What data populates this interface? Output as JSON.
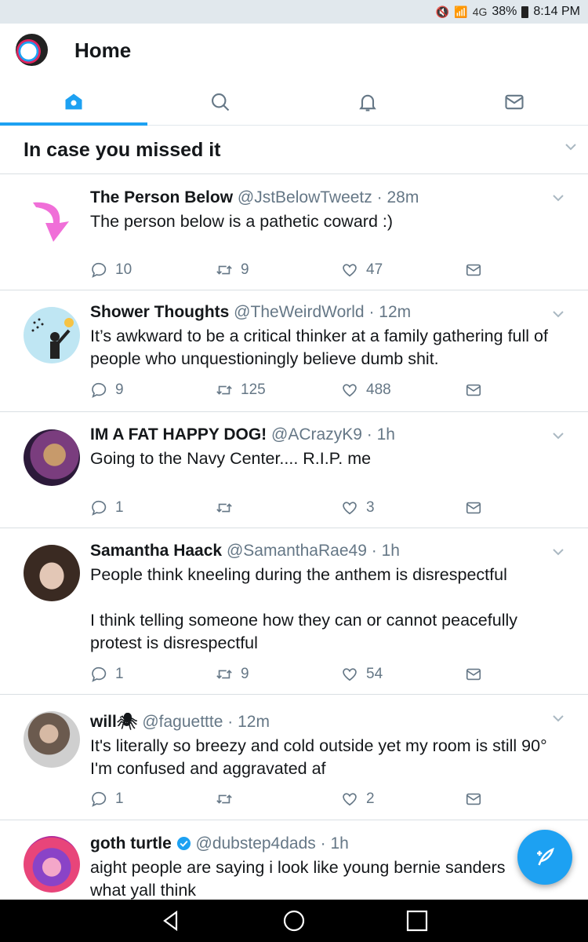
{
  "status_bar": {
    "network": "4G",
    "battery": "38%",
    "time": "8:14 PM"
  },
  "header": {
    "title": "Home"
  },
  "tabs": [
    {
      "icon": "home-icon",
      "active": true
    },
    {
      "icon": "search-icon",
      "active": false
    },
    {
      "icon": "bell-icon",
      "active": false
    },
    {
      "icon": "mail-icon",
      "active": false
    }
  ],
  "section": {
    "title": "In case you missed it"
  },
  "tweets": [
    {
      "name": "The Person Below",
      "handle": "@JstBelowTweetz",
      "time": "28m",
      "text": "The person below is a pathetic coward :)",
      "replies": "10",
      "retweets": "9",
      "likes": "47"
    },
    {
      "name": "Shower Thoughts",
      "handle": "@TheWeirdWorld",
      "time": "12m",
      "text": "It’s awkward to be a critical thinker at a family gathering full of people who unquestioningly believe dumb shit.",
      "replies": "9",
      "retweets": "125",
      "likes": "488"
    },
    {
      "name": "IM A FAT HAPPY DOG!",
      "handle": "@ACrazyK9",
      "time": "1h",
      "text": "Going to the Navy Center.... R.I.P. me",
      "replies": "1",
      "retweets": "",
      "likes": "3"
    },
    {
      "name": "Samantha Haack",
      "handle": "@SamanthaRae49",
      "time": "1h",
      "text": "People think kneeling during the anthem is disrespectful",
      "text2": "I think telling someone how they can or cannot peacefully protest is disrespectful",
      "replies": "1",
      "retweets": "9",
      "likes": "54"
    },
    {
      "name": "will🕷",
      "handle": "@faguettte",
      "time": "12m",
      "text": "It's literally so breezy and cold outside yet my room is still 90° I'm confused and aggravated af",
      "replies": "1",
      "retweets": "",
      "likes": "2"
    },
    {
      "name": "goth turtle",
      "handle": "@dubstep4dads",
      "time": "1h",
      "text": "aight people are saying i look like young bernie sanders what yall think"
    }
  ],
  "colors": {
    "accent": "#1da1f2",
    "muted": "#657786"
  }
}
